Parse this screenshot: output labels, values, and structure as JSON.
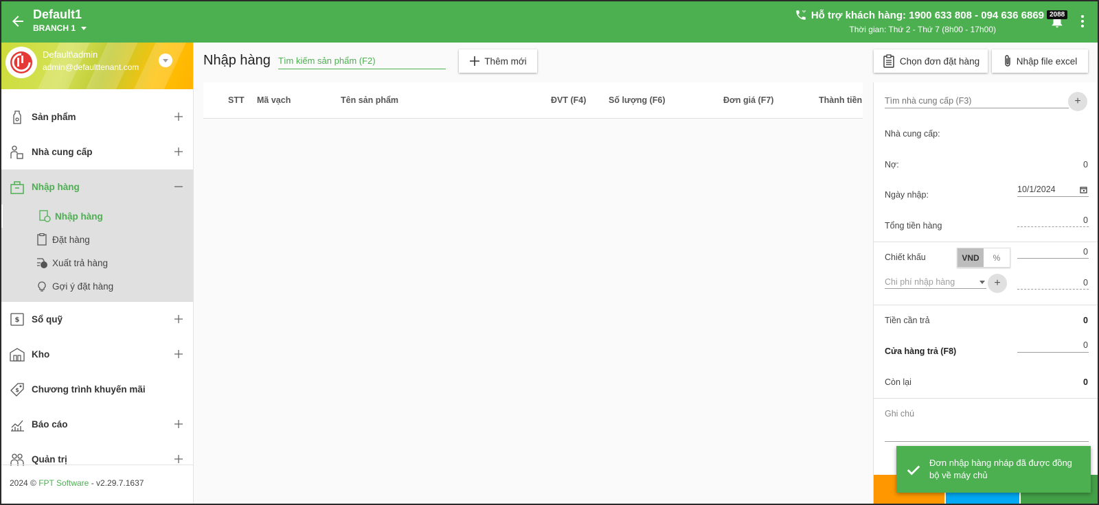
{
  "header": {
    "title": "Default1",
    "branch": "BRANCH 1",
    "support": "Hỗ trợ khách hàng: 1900 633 808 - 094 636 6869",
    "hours": "Thời gian: Thứ 2 - Thứ 7 (8h00 - 17h00)",
    "notification_count": "2088"
  },
  "user": {
    "name": "Default\\admin",
    "email": "admin@defaulttenant.com"
  },
  "sidebar": {
    "items": [
      {
        "label": "Sản phẩm"
      },
      {
        "label": "Nhà cung cấp"
      },
      {
        "label": "Nhập hàng"
      },
      {
        "label": "Sổ quỹ"
      },
      {
        "label": "Kho"
      },
      {
        "label": "Chương trình khuyến mãi"
      },
      {
        "label": "Báo cáo"
      },
      {
        "label": "Quản trị"
      }
    ],
    "sub_items": [
      {
        "label": "Nhập hàng"
      },
      {
        "label": "Đặt hàng"
      },
      {
        "label": "Xuất trả hàng"
      },
      {
        "label": "Gợi ý đặt hàng"
      }
    ]
  },
  "footer": {
    "prefix": "2024 © ",
    "brand": "FPT Software",
    "version": " - v2.29.7.1637"
  },
  "main": {
    "title": "Nhập hàng",
    "search_placeholder": "Tìm kiếm sản phẩm (F2)",
    "add_label": "Thêm mới",
    "order_label": "Chọn đơn đặt hàng",
    "excel_label": "Nhập file excel",
    "columns": [
      "STT",
      "Mã vạch",
      "Tên sản phẩm",
      "ĐVT (F4)",
      "Số lượng (F6)",
      "Đơn giá (F7)",
      "Thành tiền"
    ]
  },
  "panel": {
    "supplier_search_placeholder": "Tìm nhà cung cấp (F3)",
    "supplier_label": "Nhà cung cấp:",
    "debt_label": "Nợ:",
    "debt_value": "0",
    "date_label": "Ngày nhập:",
    "date_value": "10/1/2024",
    "total_label": "Tổng tiền hàng",
    "total_value": "0",
    "discount_label": "Chiết khấu",
    "discount_vnd": "VND",
    "discount_pct": "%",
    "discount_value": "0",
    "cost_placeholder": "Chi phí nhập hàng",
    "cost_value": "0",
    "payable_label": "Tiền cần trả",
    "payable_value": "0",
    "paid_label": "Cửa hàng trả (F8)",
    "paid_value": "0",
    "remaining_label": "Còn lại",
    "remaining_value": "0",
    "note_label": "Ghi chú"
  },
  "toast": {
    "message": "Đơn nhập hàng nháp đã được đồng bộ về máy chủ"
  },
  "colors": {
    "primary": "#4caf50",
    "orange": "#ff9800",
    "blue": "#03a9f4",
    "green_dark": "#43a047"
  }
}
